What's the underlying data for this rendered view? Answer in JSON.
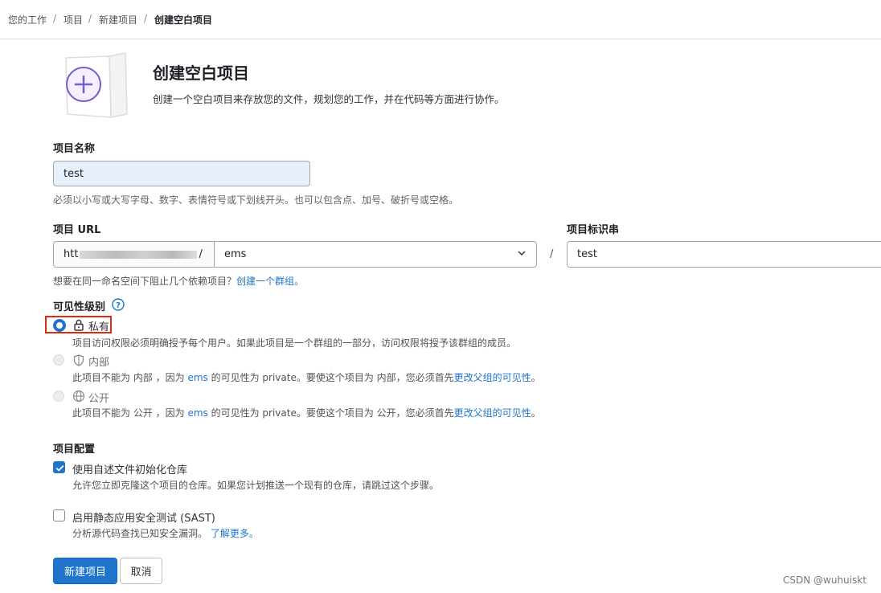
{
  "breadcrumb": {
    "items": [
      "您的工作",
      "项目",
      "新建项目"
    ],
    "current": "创建空白项目",
    "separator": "/"
  },
  "header": {
    "title": "创建空白项目",
    "description": "创建一个空白项目来存放您的文件，规划您的工作，并在代码等方面进行协作。",
    "icon": "plus-document-icon"
  },
  "project_name": {
    "label": "项目名称",
    "value": "test",
    "help": "必须以小写或大写字母、数字、表情符号或下划线开头。也可以包含点、加号、破折号或空格。"
  },
  "project_url": {
    "label": "项目 URL",
    "prefix": "htt",
    "prefix_end": "/",
    "namespace": "ems",
    "slash": "/"
  },
  "project_slug": {
    "label": "项目标识串",
    "value": "test"
  },
  "group_hint": {
    "text": "想要在同一命名空间下阻止几个依赖项目？",
    "link": "创建一个群组。"
  },
  "visibility": {
    "label": "可见性级别",
    "help_icon": "question-circle-icon",
    "options": [
      {
        "label": "私有",
        "icon": "lock-icon",
        "selected": true,
        "desc": "项目访问权限必须明确授予每个用户。如果此项目是一个群组的一部分，访问权限将授予该群组的成员。"
      },
      {
        "label": "内部",
        "icon": "shield-icon",
        "selected": false,
        "desc_pre": "此项目不能为 内部 ，因为 ",
        "desc_link1": "ems",
        "desc_mid": " 的可见性为 private。要使这个项目为 内部，您必须首先",
        "desc_link2": "更改父组的可见性",
        "desc_end": "。"
      },
      {
        "label": "公开",
        "icon": "globe-icon",
        "selected": false,
        "desc_pre": "此项目不能为 公开 ，因为 ",
        "desc_link1": "ems",
        "desc_mid": " 的可见性为 private。要使这个项目为 公开，您必须首先",
        "desc_link2": "更改父组的可见性",
        "desc_end": "。"
      }
    ]
  },
  "config": {
    "label": "项目配置",
    "readme": {
      "label": "使用自述文件初始化仓库",
      "checked": true,
      "desc": "允许您立即克隆这个项目的仓库。如果您计划推送一个现有的仓库，请跳过这个步骤。"
    },
    "sast": {
      "label": "启用静态应用安全测试 (SAST)",
      "checked": false,
      "desc": "分析源代码查找已知安全漏洞。",
      "link": "了解更多。"
    }
  },
  "actions": {
    "create": "新建项目",
    "cancel": "取消"
  },
  "watermark": "CSDN @wuhuiskt",
  "colors": {
    "accent": "#1f75cb",
    "primary_button": "#1f75cb",
    "highlight_box": "#dd2b0e",
    "icon_purple": "#7b58cf",
    "input_autofill": "#e8f0fe"
  }
}
